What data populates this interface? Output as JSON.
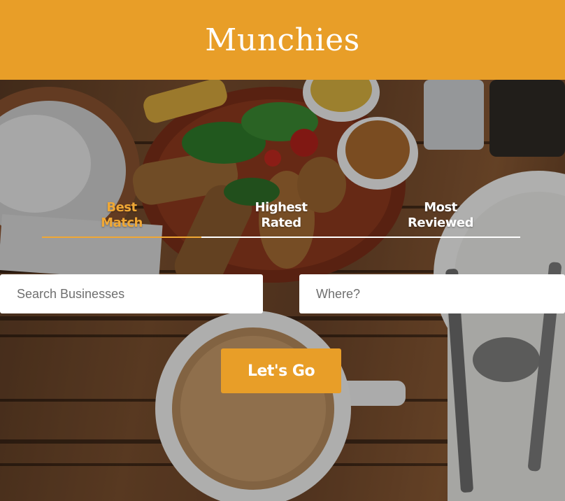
{
  "header": {
    "title": "Munchies"
  },
  "tabs": [
    {
      "label_line1": "Best",
      "label_line2": "Match",
      "active": true
    },
    {
      "label_line1": "Highest",
      "label_line2": "Rated",
      "active": false
    },
    {
      "label_line1": "Most",
      "label_line2": "Reviewed",
      "active": false
    }
  ],
  "search": {
    "business_placeholder": "Search Businesses",
    "business_value": "",
    "location_placeholder": "Where?",
    "location_value": ""
  },
  "submit": {
    "label": "Let's Go"
  },
  "colors": {
    "brand": "#e89e28",
    "active_tab": "#f0a835",
    "tab_text": "#ffffff",
    "input_bg": "#ffffff"
  }
}
